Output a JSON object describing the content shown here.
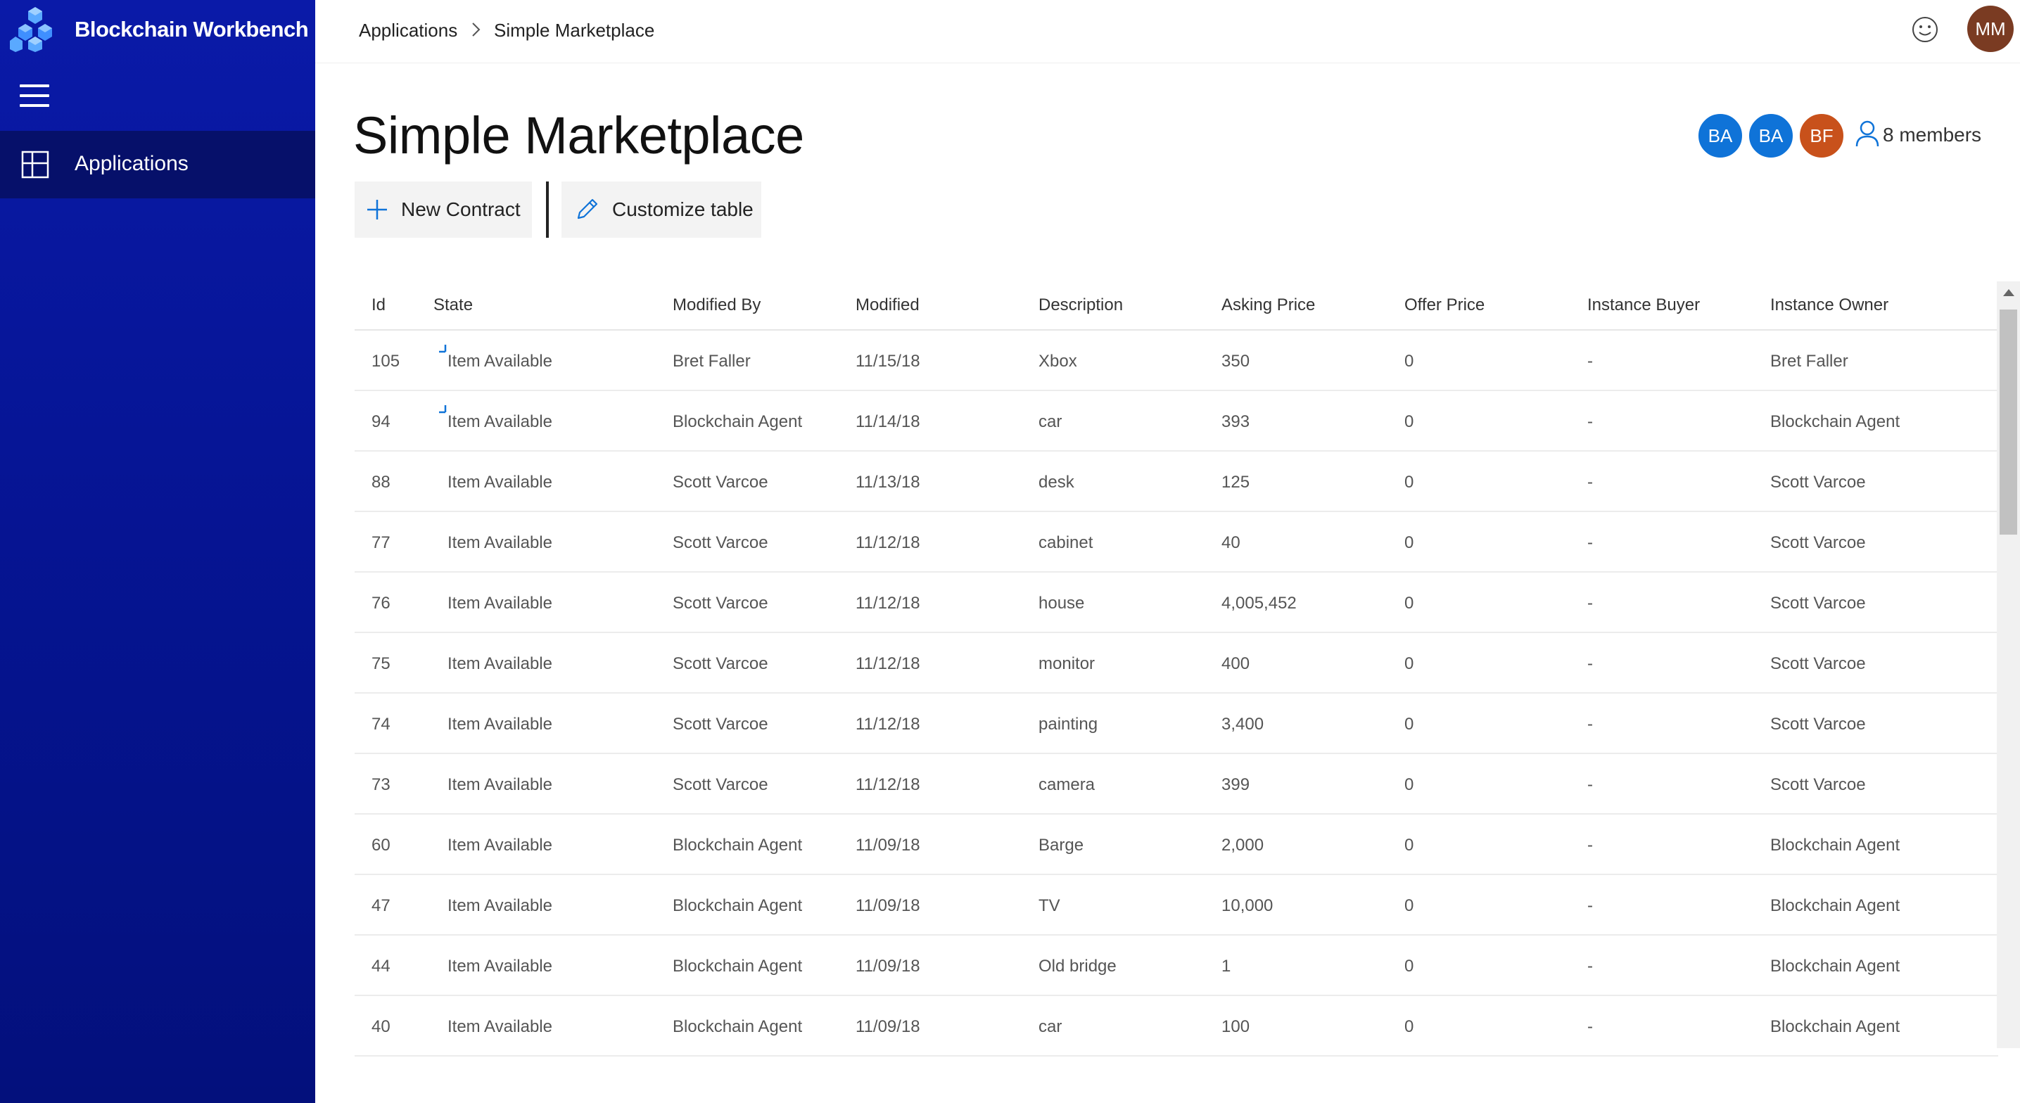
{
  "app": {
    "title": "Blockchain Workbench"
  },
  "sidebar": {
    "menu_icon": "hamburger-icon",
    "items": [
      {
        "label": "Applications",
        "icon": "apps-grid-icon",
        "selected": true
      }
    ]
  },
  "header": {
    "breadcrumb": [
      "Applications",
      "Simple Marketplace"
    ],
    "feedback_icon": "smiley-icon",
    "user_initials": "MM",
    "user_color": "#7a3b22"
  },
  "page": {
    "title": "Simple Marketplace",
    "members": {
      "avatars": [
        {
          "initials": "BA",
          "color": "#0f73d8"
        },
        {
          "initials": "BA",
          "color": "#0f73d8"
        },
        {
          "initials": "BF",
          "color": "#c8511b"
        }
      ],
      "count_label": "8 members"
    }
  },
  "toolbar": {
    "new_contract_label": "New Contract",
    "customize_label": "Customize table"
  },
  "table": {
    "columns": [
      "Id",
      "State",
      "Modified By",
      "Modified",
      "Description",
      "Asking Price",
      "Offer Price",
      "Instance Buyer",
      "Instance Owner"
    ],
    "rows": [
      {
        "id": "105",
        "state": "Item Available",
        "pending": true,
        "modified_by": "Bret Faller",
        "modified": "11/15/18",
        "description": "Xbox",
        "asking_price": "350",
        "offer_price": "0",
        "buyer": "-",
        "owner": "Bret Faller"
      },
      {
        "id": "94",
        "state": "Item Available",
        "pending": true,
        "modified_by": "Blockchain Agent",
        "modified": "11/14/18",
        "description": "car",
        "asking_price": "393",
        "offer_price": "0",
        "buyer": "-",
        "owner": "Blockchain Agent"
      },
      {
        "id": "88",
        "state": "Item Available",
        "pending": false,
        "modified_by": "Scott Varcoe",
        "modified": "11/13/18",
        "description": "desk",
        "asking_price": "125",
        "offer_price": "0",
        "buyer": "-",
        "owner": "Scott Varcoe"
      },
      {
        "id": "77",
        "state": "Item Available",
        "pending": false,
        "modified_by": "Scott Varcoe",
        "modified": "11/12/18",
        "description": "cabinet",
        "asking_price": "40",
        "offer_price": "0",
        "buyer": "-",
        "owner": "Scott Varcoe"
      },
      {
        "id": "76",
        "state": "Item Available",
        "pending": false,
        "modified_by": "Scott Varcoe",
        "modified": "11/12/18",
        "description": "house",
        "asking_price": "4,005,452",
        "offer_price": "0",
        "buyer": "-",
        "owner": "Scott Varcoe"
      },
      {
        "id": "75",
        "state": "Item Available",
        "pending": false,
        "modified_by": "Scott Varcoe",
        "modified": "11/12/18",
        "description": "monitor",
        "asking_price": "400",
        "offer_price": "0",
        "buyer": "-",
        "owner": "Scott Varcoe"
      },
      {
        "id": "74",
        "state": "Item Available",
        "pending": false,
        "modified_by": "Scott Varcoe",
        "modified": "11/12/18",
        "description": "painting",
        "asking_price": "3,400",
        "offer_price": "0",
        "buyer": "-",
        "owner": "Scott Varcoe"
      },
      {
        "id": "73",
        "state": "Item Available",
        "pending": false,
        "modified_by": "Scott Varcoe",
        "modified": "11/12/18",
        "description": "camera",
        "asking_price": "399",
        "offer_price": "0",
        "buyer": "-",
        "owner": "Scott Varcoe"
      },
      {
        "id": "60",
        "state": "Item Available",
        "pending": false,
        "modified_by": "Blockchain Agent",
        "modified": "11/09/18",
        "description": "Barge",
        "asking_price": "2,000",
        "offer_price": "0",
        "buyer": "-",
        "owner": "Blockchain Agent"
      },
      {
        "id": "47",
        "state": "Item Available",
        "pending": false,
        "modified_by": "Blockchain Agent",
        "modified": "11/09/18",
        "description": "TV",
        "asking_price": "10,000",
        "offer_price": "0",
        "buyer": "-",
        "owner": "Blockchain Agent"
      },
      {
        "id": "44",
        "state": "Item Available",
        "pending": false,
        "modified_by": "Blockchain Agent",
        "modified": "11/09/18",
        "description": "Old bridge",
        "asking_price": "1",
        "offer_price": "0",
        "buyer": "-",
        "owner": "Blockchain Agent"
      },
      {
        "id": "40",
        "state": "Item Available",
        "pending": false,
        "modified_by": "Blockchain Agent",
        "modified": "11/09/18",
        "description": "car",
        "asking_price": "100",
        "offer_price": "0",
        "buyer": "-",
        "owner": "Blockchain Agent"
      }
    ]
  },
  "colors": {
    "sidebar": "#061596",
    "accent": "#0f73d8"
  }
}
